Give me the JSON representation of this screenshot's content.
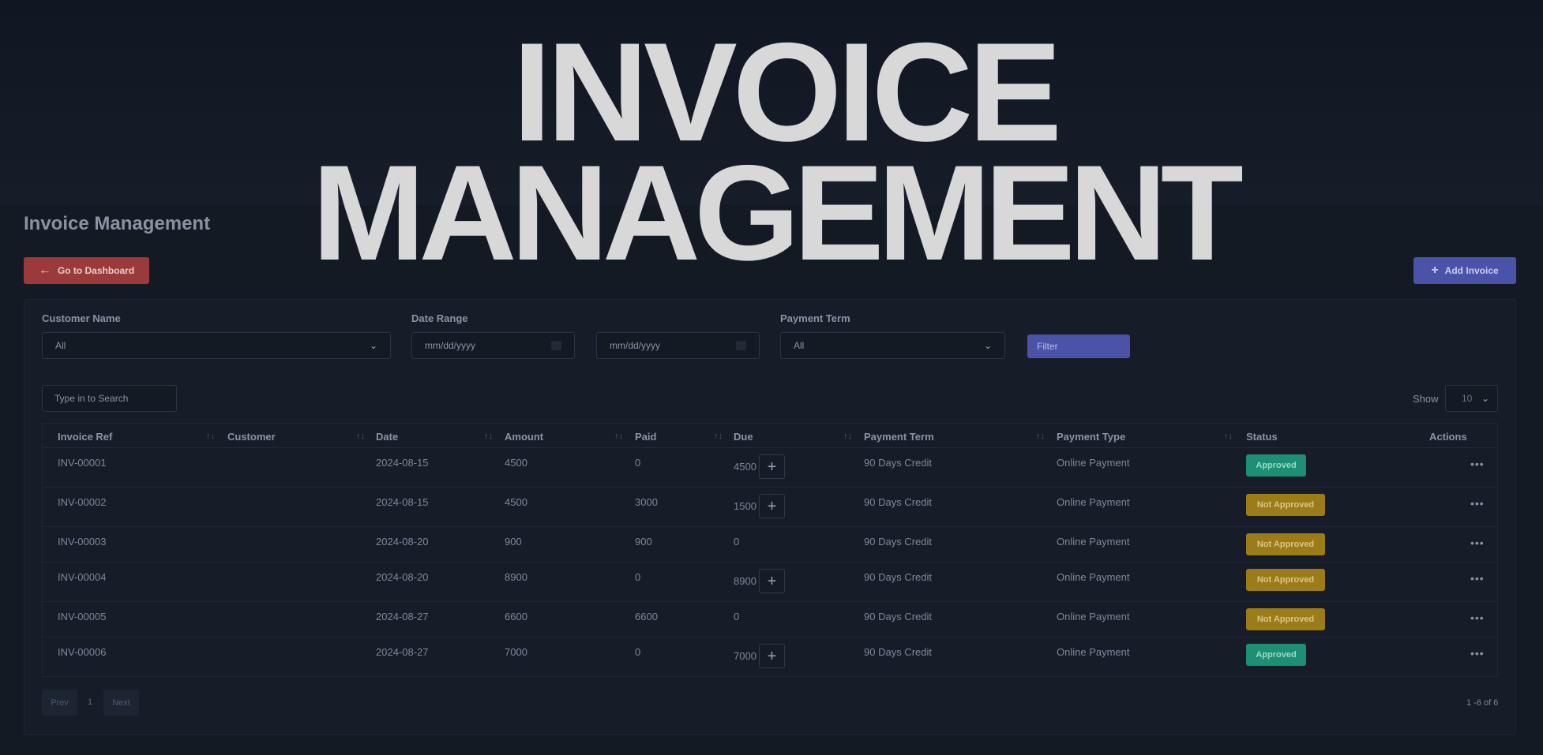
{
  "hero": {
    "line1": "INVOICE",
    "line2": "MANAGEMENT"
  },
  "page_title": "Invoice Management",
  "buttons": {
    "dashboard_label": "Go to Dashboard",
    "add_invoice_label": "Add Invoice",
    "filter_label": "Filter"
  },
  "filters": {
    "customer_label": "Customer Name",
    "customer_value": "All",
    "date_range_label": "Date Range",
    "date_from_placeholder": "mm/dd/yyyy",
    "date_to_placeholder": "mm/dd/yyyy",
    "payment_term_label": "Payment Term",
    "payment_term_value": "All"
  },
  "search": {
    "placeholder": "Type in to Search"
  },
  "show": {
    "label": "Show",
    "value": "10"
  },
  "table": {
    "headers": [
      "Invoice Ref",
      "Customer",
      "Date",
      "Amount",
      "Paid",
      "Due",
      "Payment Term",
      "Payment Type",
      "Status",
      "Actions"
    ],
    "rows": [
      {
        "ref": "INV-00001",
        "customer": "",
        "date": "2024-08-15",
        "amount": "4500",
        "paid": "0",
        "due": "4500",
        "due_action": true,
        "term": "90 Days Credit",
        "type": "Online Payment",
        "status": "Approved"
      },
      {
        "ref": "INV-00002",
        "customer": "",
        "date": "2024-08-15",
        "amount": "4500",
        "paid": "3000",
        "due": "1500",
        "due_action": true,
        "term": "90 Days Credit",
        "type": "Online Payment",
        "status": "Not Approved"
      },
      {
        "ref": "INV-00003",
        "customer": "",
        "date": "2024-08-20",
        "amount": "900",
        "paid": "900",
        "due": "0",
        "due_action": false,
        "term": "90 Days Credit",
        "type": "Online Payment",
        "status": "Not Approved"
      },
      {
        "ref": "INV-00004",
        "customer": "",
        "date": "2024-08-20",
        "amount": "8900",
        "paid": "0",
        "due": "8900",
        "due_action": true,
        "term": "90 Days Credit",
        "type": "Online Payment",
        "status": "Not Approved"
      },
      {
        "ref": "INV-00005",
        "customer": "",
        "date": "2024-08-27",
        "amount": "6600",
        "paid": "6600",
        "due": "0",
        "due_action": false,
        "term": "90 Days Credit",
        "type": "Online Payment",
        "status": "Not Approved"
      },
      {
        "ref": "INV-00006",
        "customer": "",
        "date": "2024-08-27",
        "amount": "7000",
        "paid": "0",
        "due": "7000",
        "due_action": true,
        "term": "90 Days Credit",
        "type": "Online Payment",
        "status": "Approved"
      }
    ]
  },
  "pagination": {
    "prev": "Prev",
    "page": "1",
    "next": "Next",
    "info": "1 -6 of 6"
  },
  "icons": {
    "back": "arrow-left-icon",
    "add": "plus-icon",
    "sort": "sort-icon",
    "dropdown": "chevron-down-icon",
    "calendar": "calendar-icon",
    "more": "ellipsis-icon"
  },
  "colors": {
    "background": "#141a24",
    "danger": "#9a3a3a",
    "primary": "#4a53a8",
    "approved": "#1e8f74",
    "not_approved": "#9c7c18"
  }
}
